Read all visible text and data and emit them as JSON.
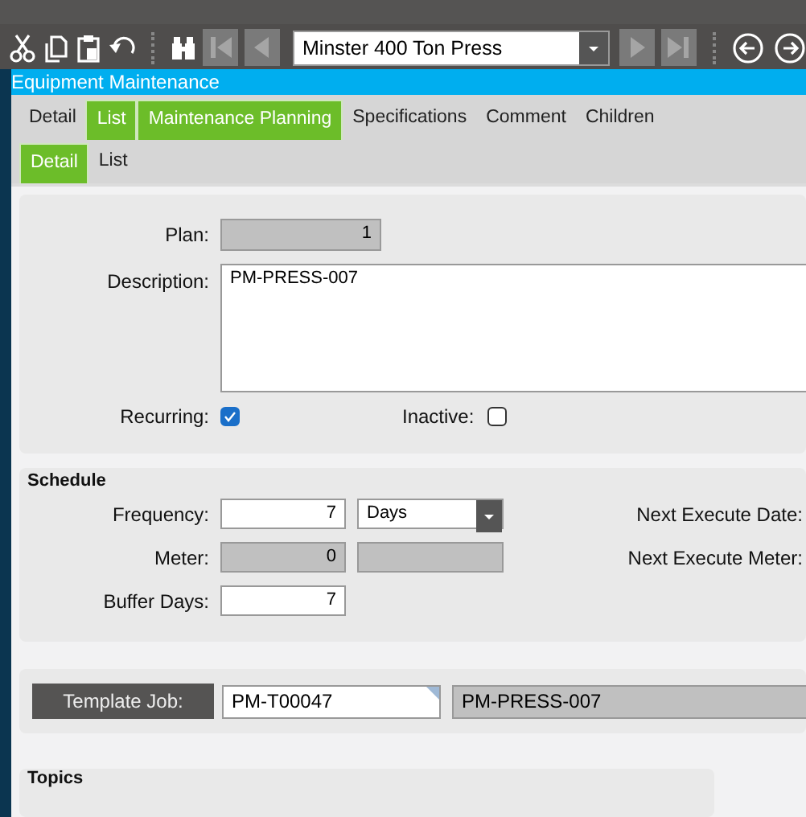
{
  "toolbar": {
    "record_selector": {
      "value": "Minster 400 Ton Press"
    }
  },
  "window": {
    "title": "Equipment Maintenance"
  },
  "tabs": [
    {
      "label": "Detail",
      "selected": false
    },
    {
      "label": "List",
      "selected": true
    },
    {
      "label": "Maintenance Planning",
      "selected": true
    },
    {
      "label": "Specifications",
      "selected": false
    },
    {
      "label": "Comment",
      "selected": false
    },
    {
      "label": "Children",
      "selected": false
    }
  ],
  "sub_tabs": [
    {
      "label": "Detail",
      "selected": true
    },
    {
      "label": "List",
      "selected": false
    }
  ],
  "plan": {
    "label": "Plan:",
    "value": "1"
  },
  "description": {
    "label": "Description:",
    "value": "PM-PRESS-007"
  },
  "recurring": {
    "label": "Recurring:",
    "checked": true
  },
  "inactive": {
    "label": "Inactive:",
    "checked": false
  },
  "schedule": {
    "title": "Schedule",
    "frequency": {
      "label": "Frequency:",
      "value": "7",
      "unit": "Days"
    },
    "meter": {
      "label": "Meter:",
      "value": "0"
    },
    "buffer_days": {
      "label": "Buffer Days:",
      "value": "7"
    },
    "next_execute_date": {
      "label": "Next Execute Date:"
    },
    "next_execute_meter": {
      "label": "Next Execute Meter:"
    }
  },
  "template_job": {
    "label": "Template Job:",
    "value": "PM-T00047",
    "description": "PM-PRESS-007"
  },
  "topics": {
    "title": "Topics"
  }
}
